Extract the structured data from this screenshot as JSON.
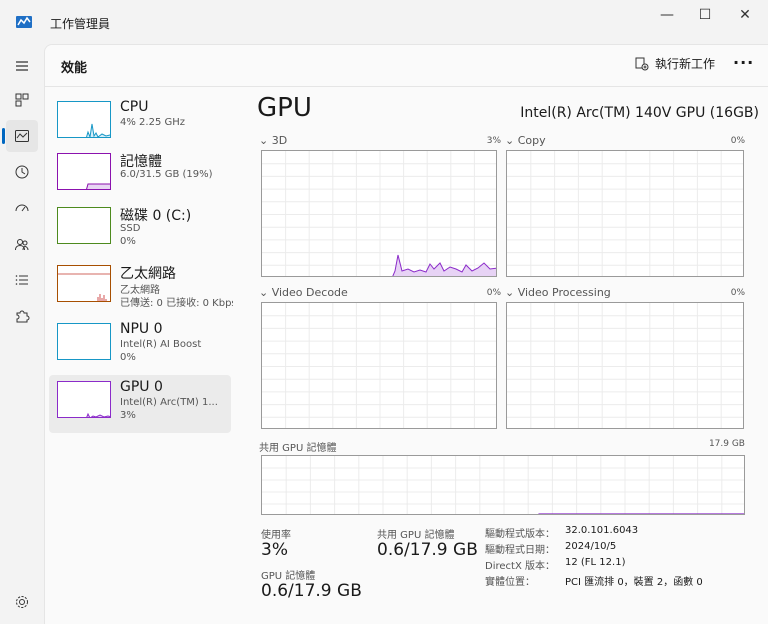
{
  "window": {
    "title": "工作管理員",
    "minimize": "—",
    "maximize": "☐",
    "close": "✕"
  },
  "header": {
    "title": "效能",
    "run_task": "執行新工作",
    "more": "···"
  },
  "resources": [
    {
      "name": "CPU",
      "sub1": "4%  2.25 GHz",
      "sub2": "",
      "sub3": ""
    },
    {
      "name": "記憶體",
      "sub1": "6.0/31.5 GB (19%)",
      "sub2": "",
      "sub3": ""
    },
    {
      "name": "磁碟 0 (C:)",
      "sub1": "SSD",
      "sub2": "0%",
      "sub3": ""
    },
    {
      "name": "乙太網路",
      "sub1": "乙太網路",
      "sub2": "已傳送: 0  已接收: 0 Kbps",
      "sub3": ""
    },
    {
      "name": "NPU 0",
      "sub1": "Intel(R) AI Boost",
      "sub2": "0%",
      "sub3": ""
    },
    {
      "name": "GPU 0",
      "sub1": "Intel(R) Arc(TM) 1...",
      "sub2": "3%",
      "sub3": ""
    }
  ],
  "detail": {
    "title": "GPU",
    "model": "Intel(R) Arc(TM) 140V GPU (16GB)",
    "graphs": [
      {
        "label": "3D",
        "pct": "3%"
      },
      {
        "label": "Copy",
        "pct": "0%"
      },
      {
        "label": "Video Decode",
        "pct": "0%"
      },
      {
        "label": "Video Processing",
        "pct": "0%"
      }
    ],
    "shared_mem_label": "共用 GPU 記憶體",
    "shared_mem_max": "17.9 GB",
    "shared_mem_level": 0.034,
    "stats": {
      "utilization_label": "使用率",
      "utilization_value": "3%",
      "shared_label": "共用 GPU 記憶體",
      "shared_value": "0.6/17.9 GB",
      "gpu_mem_label": "GPU 記憶體",
      "gpu_mem_value": "0.6/17.9 GB"
    },
    "info": [
      {
        "key": "驅動程式版本：",
        "value": "32.0.101.6043"
      },
      {
        "key": "驅動程式日期：",
        "value": "2024/10/5"
      },
      {
        "key": "DirectX 版本：",
        "value": "12 (FL 12.1)"
      },
      {
        "key": "實體位置：",
        "value": "PCI 匯流排 0，裝置 2，函數 0"
      }
    ]
  },
  "colors": {
    "accent": "#0067c0",
    "cpu": "#1797c6",
    "memory": "#8b12ae",
    "ethernet": "#a74f01",
    "gpu": "#8b2bc9",
    "gpu_fill": "#e7d3f5"
  }
}
